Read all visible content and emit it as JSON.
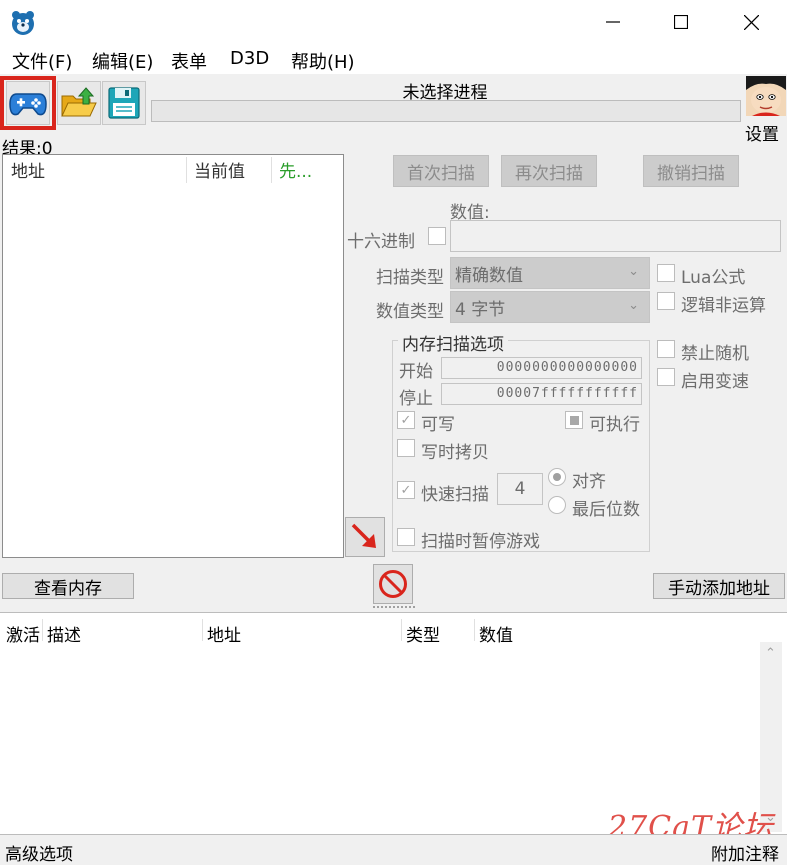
{
  "menu": {
    "file": "文件(F)",
    "edit": "编辑(E)",
    "table": "表单",
    "d3d": "D3D",
    "help": "帮助(H)"
  },
  "process": {
    "title": "未选择进程"
  },
  "settings_label": "设置",
  "result": "结果:0",
  "address_list": {
    "col_address": "地址",
    "col_current": "当前值",
    "col_previous": "先..."
  },
  "scan": {
    "first_scan": "首次扫描",
    "next_scan": "再次扫描",
    "undo_scan": "撤销扫描",
    "value_label": "数值:",
    "hex_label": "十六进制",
    "scan_type_label": "扫描类型",
    "scan_type_value": "精确数值",
    "value_type_label": "数值类型",
    "value_type_value": "4 字节",
    "lua_formula": "Lua公式",
    "logical_not": "逻辑非运算",
    "disable_random": "禁止随机",
    "enable_speedhack": "启用变速"
  },
  "memory_options": {
    "title": "内存扫描选项",
    "start_label": "开始",
    "start_value": "0000000000000000",
    "stop_label": "停止",
    "stop_value": "00007fffffffffff",
    "writable": "可写",
    "executable": "可执行",
    "copy_on_write": "写时拷贝",
    "fast_scan": "快速扫描",
    "fast_scan_value": "4",
    "align": "对齐",
    "last_digits": "最后位数",
    "pause_game": "扫描时暂停游戏"
  },
  "view_memory": "查看内存",
  "add_address_manually": "手动添加地址",
  "cheat_table": {
    "col_active": "激活",
    "col_description": "描述",
    "col_address": "地址",
    "col_type": "类型",
    "col_value": "数值"
  },
  "bottom": {
    "advanced_options": "高级选项",
    "extra_comments": "附加注释"
  },
  "watermark": "27CaT论坛",
  "colors": {
    "highlight_red": "#d9251c",
    "watermark_red": "#e0504a"
  }
}
